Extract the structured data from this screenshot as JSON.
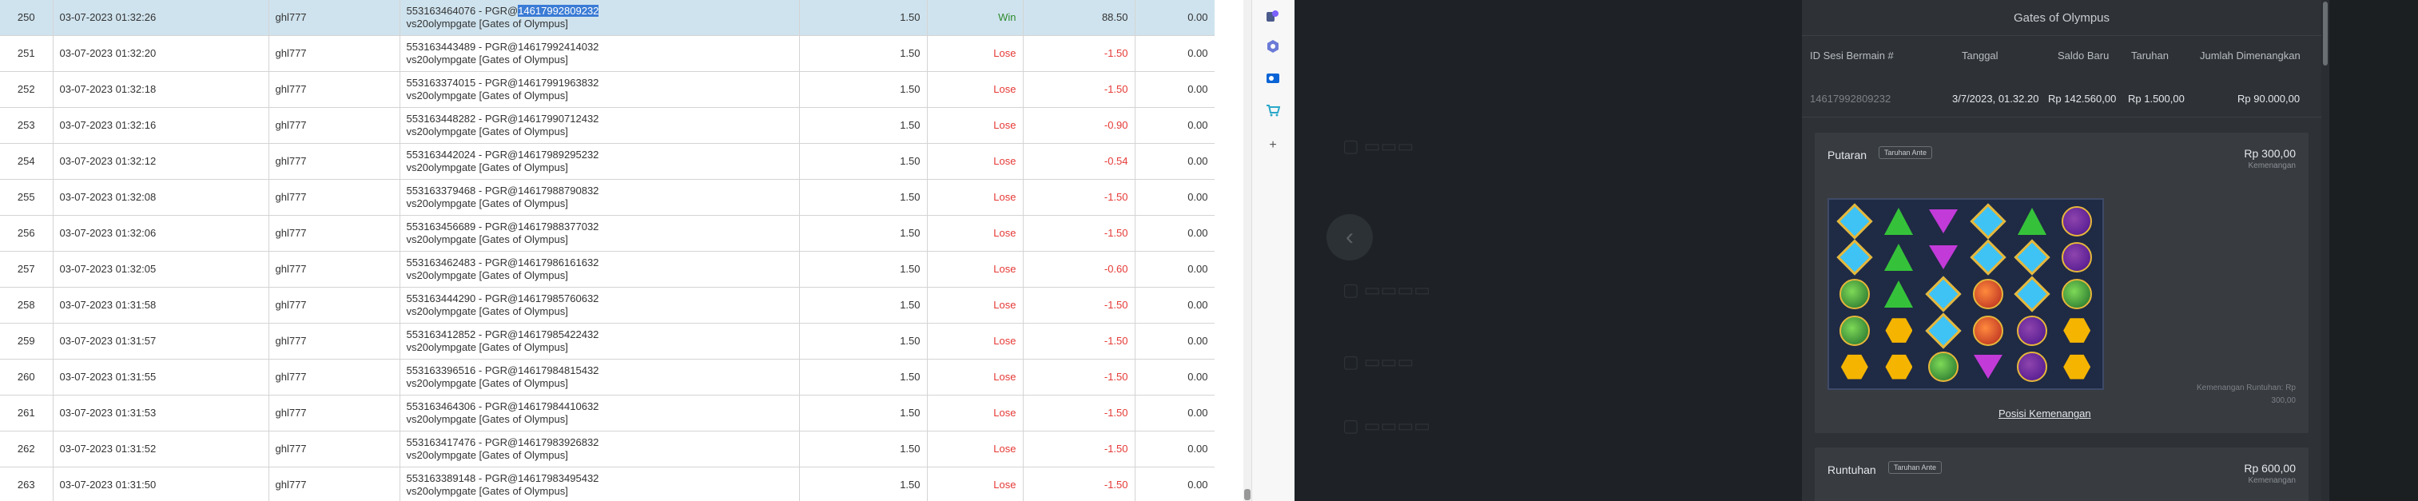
{
  "table": {
    "rows": [
      {
        "no": "250",
        "datetime": "03-07-2023 01:32:26",
        "user": "ghl777",
        "desc_prefix": "553163464076 - PGR@",
        "desc_highlight": "14617992809232",
        "desc_game": "vs20olympgate [Gates of Olympus]",
        "bet": "1.50",
        "result": "Win",
        "winloss": "88.50",
        "commission": "0.00"
      },
      {
        "no": "251",
        "datetime": "03-07-2023 01:32:20",
        "user": "ghl777",
        "desc_prefix": "553163443489 - PGR@14617992414032",
        "desc_highlight": "",
        "desc_game": "vs20olympgate [Gates of Olympus]",
        "bet": "1.50",
        "result": "Lose",
        "winloss": "-1.50",
        "commission": "0.00"
      },
      {
        "no": "252",
        "datetime": "03-07-2023 01:32:18",
        "user": "ghl777",
        "desc_prefix": "553163374015 - PGR@14617991963832",
        "desc_highlight": "",
        "desc_game": "vs20olympgate [Gates of Olympus]",
        "bet": "1.50",
        "result": "Lose",
        "winloss": "-1.50",
        "commission": "0.00"
      },
      {
        "no": "253",
        "datetime": "03-07-2023 01:32:16",
        "user": "ghl777",
        "desc_prefix": "553163448282 - PGR@14617990712432",
        "desc_highlight": "",
        "desc_game": "vs20olympgate [Gates of Olympus]",
        "bet": "1.50",
        "result": "Lose",
        "winloss": "-0.90",
        "commission": "0.00"
      },
      {
        "no": "254",
        "datetime": "03-07-2023 01:32:12",
        "user": "ghl777",
        "desc_prefix": "553163442024 - PGR@14617989295232",
        "desc_highlight": "",
        "desc_game": "vs20olympgate [Gates of Olympus]",
        "bet": "1.50",
        "result": "Lose",
        "winloss": "-0.54",
        "commission": "0.00"
      },
      {
        "no": "255",
        "datetime": "03-07-2023 01:32:08",
        "user": "ghl777",
        "desc_prefix": "553163379468 - PGR@14617988790832",
        "desc_highlight": "",
        "desc_game": "vs20olympgate [Gates of Olympus]",
        "bet": "1.50",
        "result": "Lose",
        "winloss": "-1.50",
        "commission": "0.00"
      },
      {
        "no": "256",
        "datetime": "03-07-2023 01:32:06",
        "user": "ghl777",
        "desc_prefix": "553163456689 - PGR@14617988377032",
        "desc_highlight": "",
        "desc_game": "vs20olympgate [Gates of Olympus]",
        "bet": "1.50",
        "result": "Lose",
        "winloss": "-1.50",
        "commission": "0.00"
      },
      {
        "no": "257",
        "datetime": "03-07-2023 01:32:05",
        "user": "ghl777",
        "desc_prefix": "553163462483 - PGR@14617986161632",
        "desc_highlight": "",
        "desc_game": "vs20olympgate [Gates of Olympus]",
        "bet": "1.50",
        "result": "Lose",
        "winloss": "-0.60",
        "commission": "0.00"
      },
      {
        "no": "258",
        "datetime": "03-07-2023 01:31:58",
        "user": "ghl777",
        "desc_prefix": "553163444290 - PGR@14617985760632",
        "desc_highlight": "",
        "desc_game": "vs20olympgate [Gates of Olympus]",
        "bet": "1.50",
        "result": "Lose",
        "winloss": "-1.50",
        "commission": "0.00"
      },
      {
        "no": "259",
        "datetime": "03-07-2023 01:31:57",
        "user": "ghl777",
        "desc_prefix": "553163412852 - PGR@14617985422432",
        "desc_highlight": "",
        "desc_game": "vs20olympgate [Gates of Olympus]",
        "bet": "1.50",
        "result": "Lose",
        "winloss": "-1.50",
        "commission": "0.00"
      },
      {
        "no": "260",
        "datetime": "03-07-2023 01:31:55",
        "user": "ghl777",
        "desc_prefix": "553163396516 - PGR@14617984815432",
        "desc_highlight": "",
        "desc_game": "vs20olympgate [Gates of Olympus]",
        "bet": "1.50",
        "result": "Lose",
        "winloss": "-1.50",
        "commission": "0.00"
      },
      {
        "no": "261",
        "datetime": "03-07-2023 01:31:53",
        "user": "ghl777",
        "desc_prefix": "553163464306 - PGR@14617984410632",
        "desc_highlight": "",
        "desc_game": "vs20olympgate [Gates of Olympus]",
        "bet": "1.50",
        "result": "Lose",
        "winloss": "-1.50",
        "commission": "0.00"
      },
      {
        "no": "262",
        "datetime": "03-07-2023 01:31:52",
        "user": "ghl777",
        "desc_prefix": "553163417476 - PGR@14617983926832",
        "desc_highlight": "",
        "desc_game": "vs20olympgate [Gates of Olympus]",
        "bet": "1.50",
        "result": "Lose",
        "winloss": "-1.50",
        "commission": "0.00"
      },
      {
        "no": "263",
        "datetime": "03-07-2023 01:31:50",
        "user": "ghl777",
        "desc_prefix": "553163389148 - PGR@14617983495432",
        "desc_highlight": "",
        "desc_game": "vs20olympgate [Gates of Olympus]",
        "bet": "1.50",
        "result": "Lose",
        "winloss": "-1.50",
        "commission": "0.00"
      }
    ]
  },
  "icon_bar": [
    "profile-switch-icon",
    "extension-hex-icon",
    "outlook-icon",
    "cart-icon",
    "add-icon"
  ],
  "game_panel": {
    "title": "Gates of Olympus",
    "headers": {
      "session_id": "ID Sesi Bermain #",
      "date": "Tanggal",
      "balance": "Saldo Baru",
      "bet": "Taruhan",
      "win": "Jumlah Dimenangkan"
    },
    "values": {
      "session_id": "14617992809232",
      "date": "3/7/2023, 01.32.20",
      "balance": "Rp 142.560,00",
      "bet": "Rp 1.500,00",
      "win": "Rp 90.000,00"
    },
    "spin": {
      "title": "Putaran",
      "tag": "Taruhan Ante",
      "amount": "Rp 300,00",
      "amount_label": "Kemenangan",
      "positions_link": "Posisi Kemenangan",
      "cascade_note": "Kemenangan Runtuhan: Rp 300,00"
    },
    "tumble": {
      "title": "Runtuhan",
      "tag": "Taruhan Ante",
      "amount": "Rp 600,00",
      "amount_label": "Kemenangan"
    },
    "reels": [
      [
        "blue",
        "green",
        "purple",
        "blue",
        "green",
        "ring"
      ],
      [
        "blue",
        "green",
        "purple",
        "blue",
        "blue",
        "ring"
      ],
      [
        "crown",
        "green",
        "blue",
        "red",
        "blue",
        "crown"
      ],
      [
        "crown",
        "yellow",
        "blue",
        "red",
        "ring",
        "yellow"
      ],
      [
        "yellow",
        "yellow",
        "crown",
        "purple",
        "ring",
        "yellow"
      ]
    ]
  },
  "colors": {
    "win": "#2e8b2e",
    "lose": "#e53935",
    "highlight_row": "#cfe3ee",
    "panel_bg": "#2e3236"
  }
}
